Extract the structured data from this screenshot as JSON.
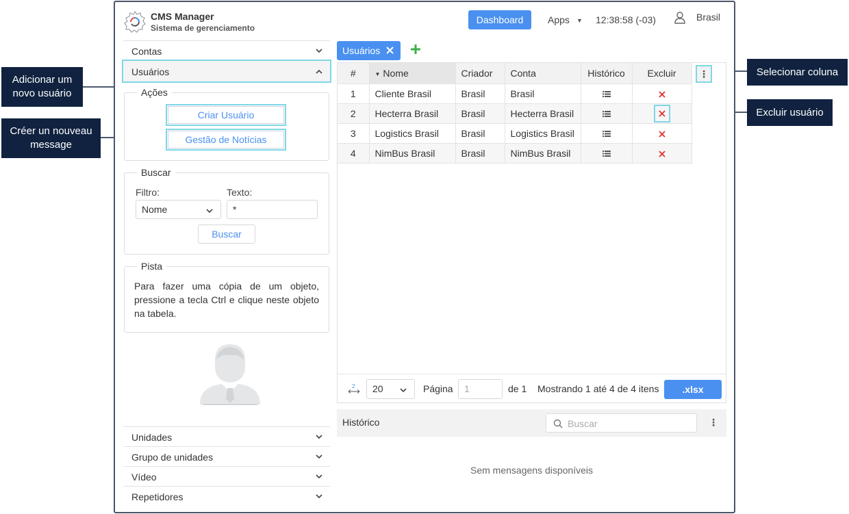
{
  "header": {
    "app_title": "CMS Manager",
    "app_subtitle": "Sistema de gerenciamento",
    "dashboard_label": "Dashboard",
    "apps_label": "Apps",
    "clock": "12:38:58 (-03)",
    "user_name": "Brasil"
  },
  "sidebar": {
    "contas": "Contas",
    "usuarios": "Usuários",
    "acoes_title": "Ações",
    "criar_usuario": "Criar Usuário",
    "gestao_noticias": "Gestão de Notícias",
    "buscar_title": "Buscar",
    "filtro_label": "Filtro:",
    "filtro_value": "Nome",
    "texto_label": "Texto:",
    "texto_value": "*",
    "buscar_button": "Buscar",
    "pista_title": "Pista",
    "pista_text": "Para fazer uma cópia de um objeto, pressione a tecla Ctrl e clique neste objeto na tabela.",
    "bottom_items": [
      "Unidades",
      "Grupo de unidades",
      "Vídeo",
      "Repetidores"
    ]
  },
  "main": {
    "tab_label": "Usuários",
    "columns": [
      "#",
      "Nome",
      "Criador",
      "Conta",
      "Histórico",
      "Excluir"
    ],
    "rows": [
      {
        "num": "1",
        "nome": "Cliente Brasil",
        "criador": "Brasil",
        "conta": "Brasil"
      },
      {
        "num": "2",
        "nome": "Hecterra Brasil",
        "criador": "Brasil",
        "conta": "Hecterra Brasil"
      },
      {
        "num": "3",
        "nome": "Logistics Brasil",
        "criador": "Brasil",
        "conta": "Logistics Brasil"
      },
      {
        "num": "4",
        "nome": "NimBus Brasil",
        "criador": "Brasil",
        "conta": "NimBus Brasil"
      }
    ],
    "column_menu": "⋮",
    "pager": {
      "page_size": "20",
      "pagina_label": "Página",
      "page_input_placeholder": "1",
      "de_label": "de 1",
      "showing": "Mostrando 1 até 4 de 4 itens",
      "xlsx": ".xlsx",
      "resize_number": "2"
    },
    "historico": {
      "title": "Histórico",
      "search_placeholder": "Buscar",
      "menu": "⋮",
      "empty": "Sem mensagens disponíveis"
    }
  },
  "callouts": {
    "add_user": "Adicionar um novo usuário",
    "new_message": "Créer un nouveau message",
    "select_column": "Selecionar coluna",
    "delete_user": "Excluir usuário"
  },
  "colors": {
    "accent": "#4a90f0",
    "highlight": "#7fd6e6",
    "callout_bg": "#10223f",
    "delete_red": "#e03030"
  }
}
